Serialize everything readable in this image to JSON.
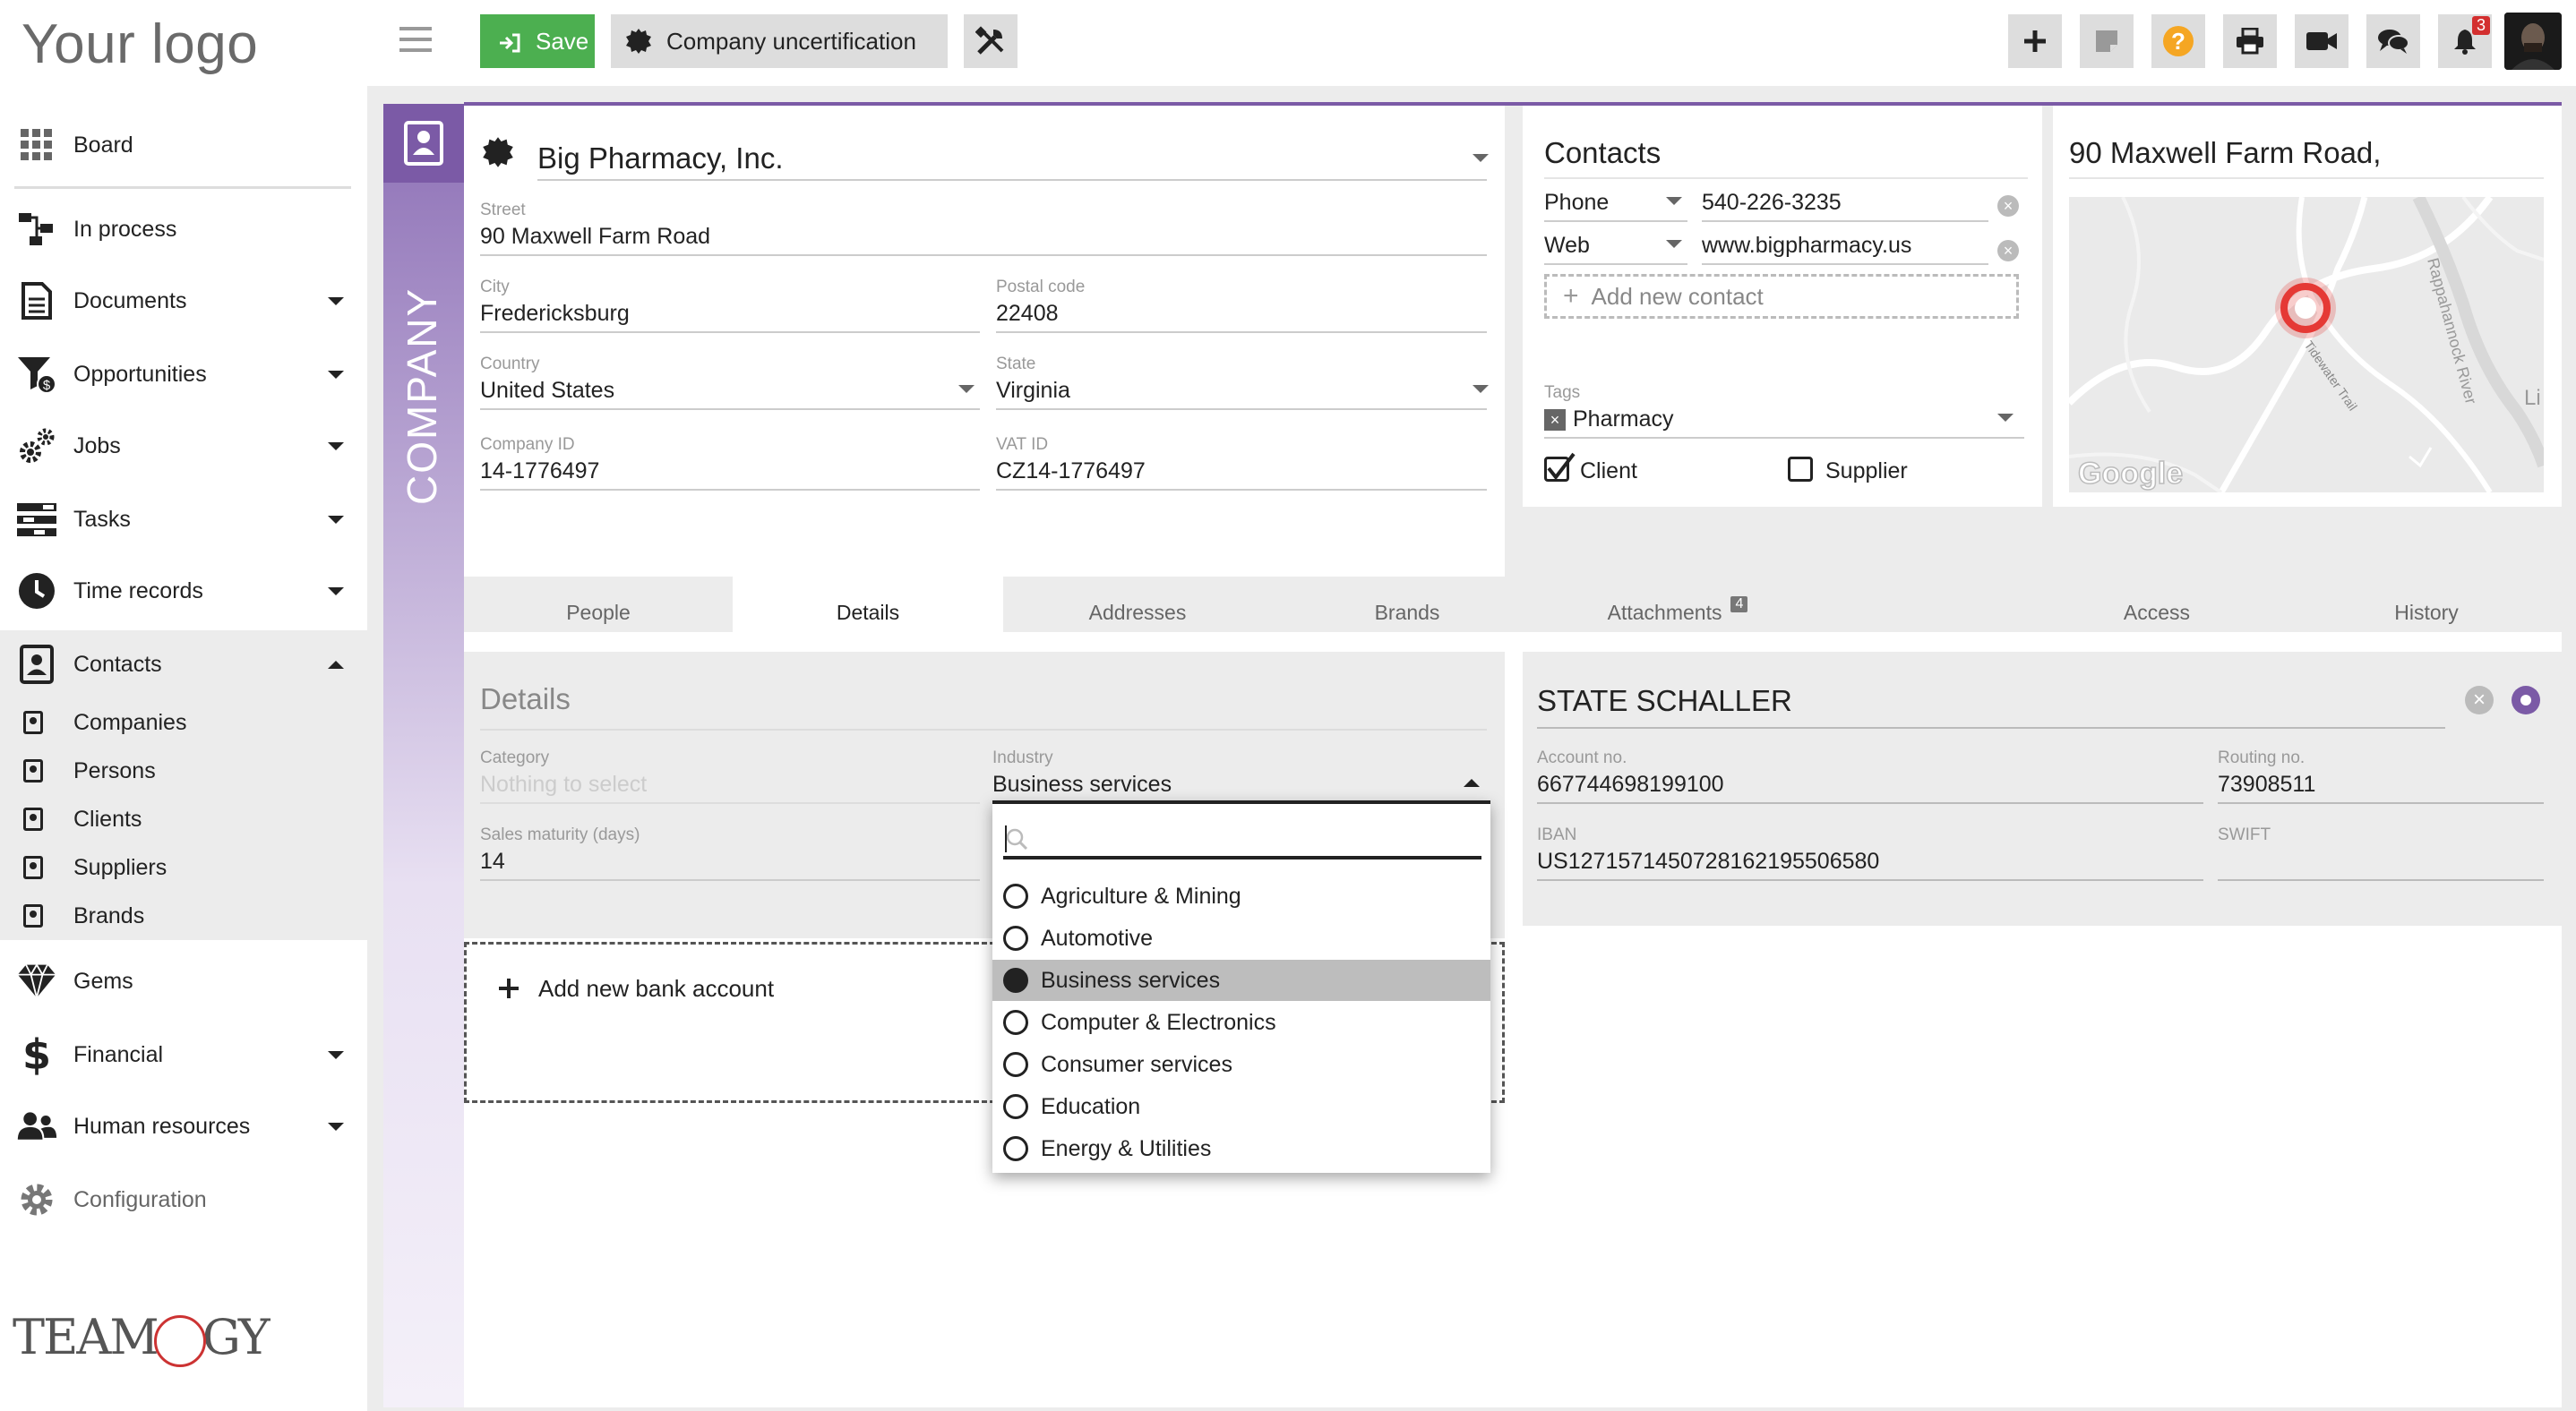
{
  "logo": "Your logo",
  "sidebar": {
    "items": [
      {
        "label": "Board",
        "caret": false
      },
      {
        "label": "In process",
        "caret": false
      },
      {
        "label": "Documents",
        "caret": true
      },
      {
        "label": "Opportunities",
        "caret": true
      },
      {
        "label": "Jobs",
        "caret": true
      },
      {
        "label": "Tasks",
        "caret": true
      },
      {
        "label": "Time records",
        "caret": true
      },
      {
        "label": "Contacts",
        "caret": true,
        "expanded": true
      },
      {
        "label": "Gems",
        "caret": false
      },
      {
        "label": "Financial",
        "caret": true
      },
      {
        "label": "Human resources",
        "caret": true
      },
      {
        "label": "Configuration",
        "caret": false
      }
    ],
    "contacts_sub": [
      "Companies",
      "Persons",
      "Clients",
      "Suppliers",
      "Brands"
    ],
    "footer_logo_left": "TEAM",
    "footer_logo_right": "GY"
  },
  "toolbar": {
    "save_label": "Save",
    "uncert_label": "Company uncertification",
    "notification_count": "3"
  },
  "company": {
    "band_label": "COMPANY",
    "name": "Big Pharmacy, Inc.",
    "street_label": "Street",
    "street": "90  Maxwell Farm Road",
    "city_label": "City",
    "city": "Fredericksburg",
    "postal_label": "Postal code",
    "postal": "22408",
    "country_label": "Country",
    "country": "United States",
    "state_label": "State",
    "state": "Virginia",
    "company_id_label": "Company ID",
    "company_id": "14-1776497",
    "vat_label": "VAT ID",
    "vat": "CZ14-1776497"
  },
  "contacts": {
    "title": "Contacts",
    "rows": [
      {
        "type": "Phone",
        "value": "540-226-3235"
      },
      {
        "type": "Web",
        "value": "www.bigpharmacy.us"
      }
    ],
    "add_label": "Add new contact",
    "tags_label": "Tags",
    "tag": "Pharmacy",
    "client_label": "Client",
    "supplier_label": "Supplier"
  },
  "map": {
    "address": "90 Maxwell Farm Road,",
    "labels": [
      "Rappahannock River",
      "Tidewater Trail",
      "Google",
      "Li"
    ]
  },
  "tabs": [
    {
      "label": "People"
    },
    {
      "label": "Details",
      "active": true
    },
    {
      "label": "Addresses"
    },
    {
      "label": "Brands"
    },
    {
      "label": "Attachments",
      "badge": "4"
    },
    {
      "label": "Access"
    },
    {
      "label": "History"
    }
  ],
  "details": {
    "title": "Details",
    "category_label": "Category",
    "category_placeholder": "Nothing to select",
    "industry_label": "Industry",
    "industry": "Business services",
    "maturity_label": "Sales maturity (days)",
    "maturity": "14",
    "add_bank_label": "Add new bank account"
  },
  "bank": {
    "name": "STATE SCHALLER",
    "account_label": "Account no.",
    "account": "667744698199100",
    "routing_label": "Routing no.",
    "routing": "73908511",
    "iban_label": "IBAN",
    "iban": "US127157145072816219550658​0",
    "swift_label": "SWIFT",
    "swift": ""
  },
  "industry_dropdown": {
    "search_value": "",
    "options": [
      {
        "label": "Agriculture & Mining",
        "selected": false
      },
      {
        "label": "Automotive",
        "selected": false
      },
      {
        "label": "Business services",
        "selected": true
      },
      {
        "label": "Computer & Electronics",
        "selected": false
      },
      {
        "label": "Consumer services",
        "selected": false
      },
      {
        "label": "Education",
        "selected": false
      },
      {
        "label": "Energy & Utilities",
        "selected": false
      }
    ]
  },
  "colors": {
    "accent": "#7b5aa6",
    "save": "#4caf50",
    "help": "#f5a623",
    "badge": "#d32f2f",
    "map_marker": "#e53935"
  }
}
